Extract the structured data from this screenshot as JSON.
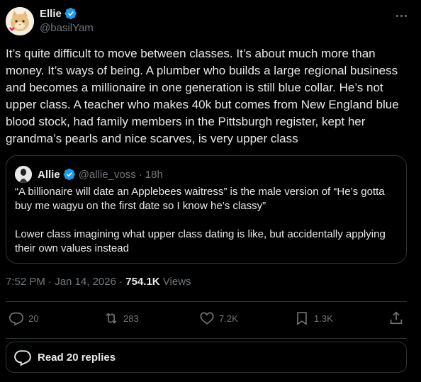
{
  "author": {
    "display_name": "Ellie",
    "handle": "@basilYam"
  },
  "post": {
    "text": "It’s quite difficult to move between classes. It’s about much more than money. It’s ways of being. A plumber who builds a large regional business and becomes a millionaire in one generation is still blue collar. He’s not upper class. A teacher who makes 40k but comes from New England blue blood stock, had family members in the Pittsburgh register, kept her grandma’s pearls and nice scarves, is very upper class"
  },
  "quote": {
    "display_name": "Allie",
    "handle": "@allie_voss",
    "separator": "·",
    "time": "18h",
    "paragraph1": "“A billionaire will date an Applebees waitress” is the male version of “He’s gotta buy me wagyu on the first date so I know he’s classy”",
    "paragraph2": "Lower class imagining what upper class dating is like, but accidentally applying their own values instead"
  },
  "meta": {
    "timestamp": "7:52 PM · Jan 14, 2026 · ",
    "views_count": "754.1K",
    "views_label": " Views"
  },
  "actions": {
    "reply_count": "20",
    "repost_count": "283",
    "like_count": "7.2K",
    "bookmark_count": "1.3K"
  },
  "replies_button": {
    "label": "Read 20 replies"
  },
  "colors": {
    "background": "#000000",
    "text": "#e7e9ea",
    "muted": "#71767b",
    "border": "#2f3336",
    "verified": "#1d9bf0"
  },
  "icons": [
    "cat-avatar",
    "verified-badge-icon",
    "more-icon",
    "reply-icon",
    "repost-icon",
    "like-icon",
    "bookmark-icon",
    "share-icon",
    "replies-bubble-icon"
  ]
}
